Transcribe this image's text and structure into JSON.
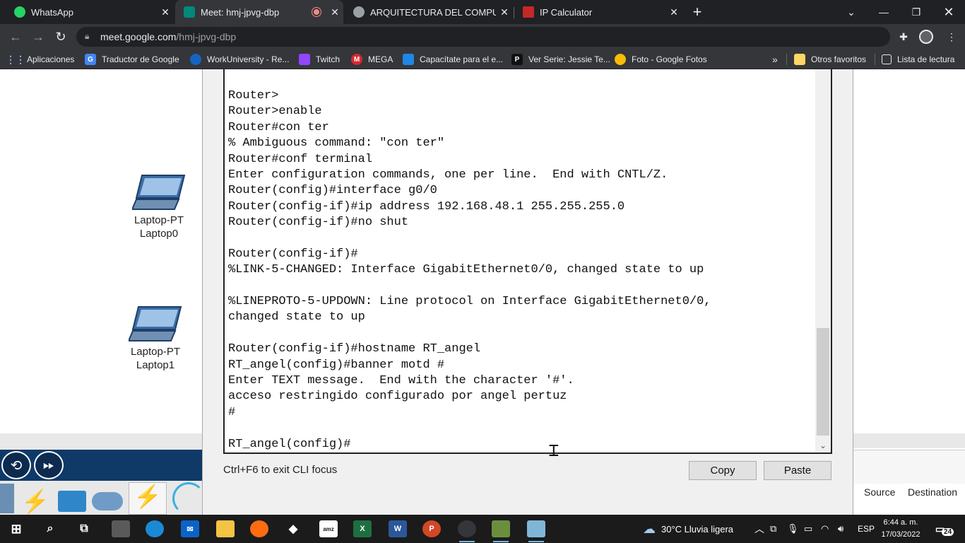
{
  "browser": {
    "tabs": [
      {
        "title": "WhatsApp",
        "active": false
      },
      {
        "title": "Meet: hmj-jpvg-dbp",
        "active": true,
        "recording": true
      },
      {
        "title": "ARQUITECTURA DEL COMPUTAD",
        "active": false
      },
      {
        "title": "IP Calculator",
        "active": false
      }
    ],
    "new_tab_label": "+",
    "url_host": "meet.google.com",
    "url_path": "/hmj-jpvg-dbp",
    "bookmarks": [
      "Aplicaciones",
      "Traductor de Google",
      "WorkUniversity - Re...",
      "Twitch",
      "MEGA",
      "Capacítate para el e...",
      "Ver Serie: Jessie Te...",
      "Foto - Google Fotos"
    ],
    "bookmarks_overflow": "»",
    "other_favorites": "Otros favoritos",
    "reading_list": "Lista de lectura"
  },
  "packet_tracer": {
    "devices": [
      {
        "type": "Laptop-PT",
        "name": "Laptop0"
      },
      {
        "type": "Laptop-PT",
        "name": "Laptop1"
      }
    ],
    "pdu_columns": [
      "Source",
      "Destination"
    ]
  },
  "cli": {
    "lines": [
      "Router>",
      "Router>enable",
      "Router#con ter",
      "% Ambiguous command: \"con ter\"",
      "Router#conf terminal",
      "Enter configuration commands, one per line.  End with CNTL/Z.",
      "Router(config)#interface g0/0",
      "Router(config-if)#ip address 192.168.48.1 255.255.255.0",
      "Router(config-if)#no shut",
      "",
      "Router(config-if)#",
      "%LINK-5-CHANGED: Interface GigabitEthernet0/0, changed state to up",
      "",
      "%LINEPROTO-5-UPDOWN: Line protocol on Interface GigabitEthernet0/0,",
      "changed state to up",
      "",
      "Router(config-if)#hostname RT_angel",
      "RT_angel(config)#banner motd #",
      "Enter TEXT message.  End with the character '#'.",
      "acceso restringido configurado por angel pertuz",
      "#",
      "",
      "RT_angel(config)#"
    ],
    "hint": "Ctrl+F6 to exit CLI focus",
    "copy_label": "Copy",
    "paste_label": "Paste"
  },
  "taskbar": {
    "weather": "30°C  Lluvia ligera",
    "language": "ESP",
    "time": "6:44 a. m.",
    "date": "17/03/2022",
    "notification_count": "24"
  }
}
